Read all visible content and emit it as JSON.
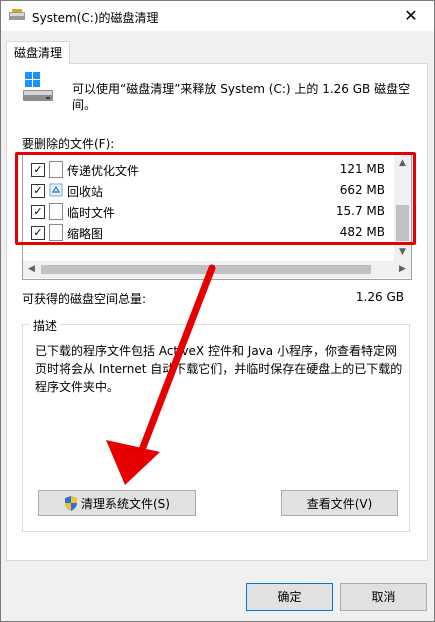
{
  "window": {
    "title": "System(C:)的磁盘清理",
    "close_glyph": "✕"
  },
  "tab": {
    "label": "磁盘清理"
  },
  "intro_text": "可以使用“磁盘清理”来释放 System (C:) 上的 1.26 GB 磁盘空间。",
  "files_label": "要删除的文件(F):",
  "file_list": [
    {
      "name": "传递优化文件",
      "size": "121 MB",
      "checked": true,
      "icon": "file-icon"
    },
    {
      "name": "回收站",
      "size": "662 MB",
      "checked": true,
      "icon": "recycle-bin-icon"
    },
    {
      "name": "临时文件",
      "size": "15.7 MB",
      "checked": true,
      "icon": "file-icon"
    },
    {
      "name": "缩略图",
      "size": "482 MB",
      "checked": true,
      "icon": "file-icon"
    }
  ],
  "space": {
    "label": "可获得的磁盘空间总量:",
    "value": "1.26 GB"
  },
  "description": {
    "title": "描述",
    "text": "已下载的程序文件包括 ActiveX 控件和 Java 小程序，你查看特定网页时将会从 Internet 自动下载它们，并临时保存在硬盘上的已下载的程序文件夹中。"
  },
  "buttons": {
    "clean_system": "清理系统文件(S)",
    "view_files": "查看文件(V)",
    "ok": "确定",
    "cancel": "取消"
  },
  "colors": {
    "annotation_red": "#e60000",
    "default_button_border": "#0078d7"
  },
  "annotation": {
    "type": "arrow",
    "target": "clean-system-files-button"
  }
}
